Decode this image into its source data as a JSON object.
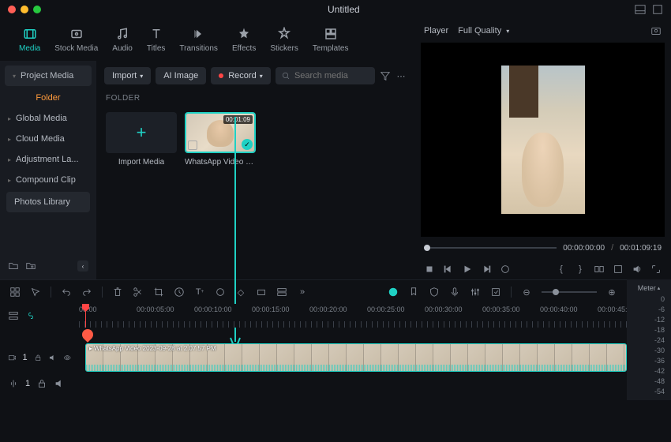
{
  "title": "Untitled",
  "tabs": [
    "Media",
    "Stock Media",
    "Audio",
    "Titles",
    "Transitions",
    "Effects",
    "Stickers",
    "Templates"
  ],
  "sidebar": {
    "project": "Project Media",
    "folder": "Folder",
    "items": [
      "Global Media",
      "Cloud Media",
      "Adjustment La...",
      "Compound Clip",
      "Photos Library"
    ]
  },
  "toolbar": {
    "import": "Import",
    "ai_image": "AI Image",
    "record": "Record",
    "search_ph": "Search media"
  },
  "folder_label": "FOLDER",
  "thumbs": {
    "import": "Import Media",
    "clip_name": "WhatsApp Video 202…",
    "duration": "00:01:09"
  },
  "player": {
    "label": "Player",
    "quality": "Full Quality",
    "current": "00:00:00:00",
    "total": "00:01:09:19"
  },
  "ruler": [
    "00:00",
    "00:00:05:00",
    "00:00:10:00",
    "00:00:15:00",
    "00:00:20:00",
    "00:00:25:00",
    "00:00:30:00",
    "00:00:35:00",
    "00:00:40:00",
    "00:00:45:"
  ],
  "clip_label": "WhatsApp Video 2023-09-28 at 2.07.57 PM",
  "tracks": {
    "video": "1",
    "audio": "1"
  },
  "meter": {
    "label": "Meter",
    "scale": [
      "0",
      "-6",
      "-12",
      "-18",
      "-24",
      "-30",
      "-36",
      "-42",
      "-48",
      "-54"
    ]
  }
}
